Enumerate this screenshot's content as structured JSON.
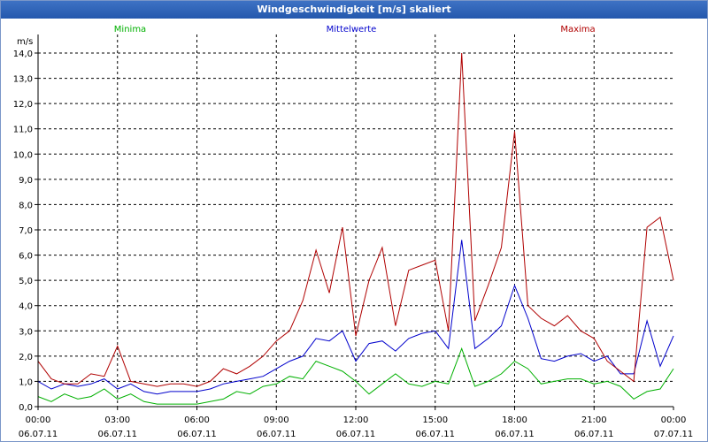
{
  "window": {
    "title": "Windgeschwindigkeit [m/s] skaliert"
  },
  "chart_data": {
    "type": "line",
    "title": "Windgeschwindigkeit [m/s] skaliert",
    "ylabel": "m/s",
    "ylim": [
      0,
      14
    ],
    "xlim": [
      0,
      24
    ],
    "y_ticks": [
      "0,0",
      "1,0",
      "2,0",
      "3,0",
      "4,0",
      "5,0",
      "6,0",
      "7,0",
      "8,0",
      "9,0",
      "10,0",
      "11,0",
      "12,0",
      "13,0",
      "14,0"
    ],
    "x_ticks": [
      {
        "time": "00:00",
        "date": "06.07.11"
      },
      {
        "time": "03:00",
        "date": "06.07.11"
      },
      {
        "time": "06:00",
        "date": "06.07.11"
      },
      {
        "time": "09:00",
        "date": "06.07.11"
      },
      {
        "time": "12:00",
        "date": "06.07.11"
      },
      {
        "time": "15:00",
        "date": "06.07.11"
      },
      {
        "time": "18:00",
        "date": "06.07.11"
      },
      {
        "time": "21:00",
        "date": "06.07.11"
      },
      {
        "time": "00:00",
        "date": "07.07.11"
      }
    ],
    "grid": true,
    "legend_position": "top",
    "series": [
      {
        "name": "Minima",
        "color": "#00b000",
        "x": [
          0,
          0.5,
          1,
          1.5,
          2,
          2.5,
          3,
          3.5,
          4,
          4.5,
          5,
          5.5,
          6,
          6.5,
          7,
          7.5,
          8,
          8.5,
          9,
          9.5,
          10,
          10.5,
          11,
          11.5,
          12,
          12.5,
          13,
          13.5,
          14,
          14.5,
          15,
          15.5,
          16,
          16.5,
          17,
          17.5,
          18,
          18.5,
          19,
          19.5,
          20,
          20.5,
          21,
          21.5,
          22,
          22.5,
          23,
          23.5,
          24
        ],
        "values": [
          0.4,
          0.2,
          0.5,
          0.3,
          0.4,
          0.7,
          0.3,
          0.5,
          0.2,
          0.1,
          0.1,
          0.1,
          0.1,
          0.2,
          0.3,
          0.6,
          0.5,
          0.8,
          0.9,
          1.2,
          1.1,
          1.8,
          1.6,
          1.4,
          1.0,
          0.5,
          0.9,
          1.3,
          0.9,
          0.8,
          1.0,
          0.9,
          2.3,
          0.8,
          1.0,
          1.3,
          1.8,
          1.5,
          0.9,
          1.0,
          1.1,
          1.1,
          0.9,
          1.0,
          0.8,
          0.3,
          0.6,
          0.7,
          1.5
        ]
      },
      {
        "name": "Mittelwerte",
        "color": "#0000cc",
        "x": [
          0,
          0.5,
          1,
          1.5,
          2,
          2.5,
          3,
          3.5,
          4,
          4.5,
          5,
          5.5,
          6,
          6.5,
          7,
          7.5,
          8,
          8.5,
          9,
          9.5,
          10,
          10.5,
          11,
          11.5,
          12,
          12.5,
          13,
          13.5,
          14,
          14.5,
          15,
          15.5,
          16,
          16.5,
          17,
          17.5,
          18,
          18.5,
          19,
          19.5,
          20,
          20.5,
          21,
          21.5,
          22,
          22.5,
          23,
          23.5,
          24
        ],
        "values": [
          1.0,
          0.7,
          0.9,
          0.8,
          0.9,
          1.1,
          0.7,
          0.9,
          0.6,
          0.5,
          0.6,
          0.6,
          0.6,
          0.7,
          0.9,
          1.0,
          1.1,
          1.2,
          1.5,
          1.8,
          2.0,
          2.7,
          2.6,
          3.0,
          1.8,
          2.5,
          2.6,
          2.2,
          2.7,
          2.9,
          3.0,
          2.3,
          6.6,
          2.3,
          2.7,
          3.2,
          4.8,
          3.5,
          1.9,
          1.8,
          2.0,
          2.1,
          1.8,
          2.0,
          1.3,
          1.3,
          3.4,
          1.6,
          2.8
        ]
      },
      {
        "name": "Maxima",
        "color": "#b00000",
        "x": [
          0,
          0.5,
          1,
          1.5,
          2,
          2.5,
          3,
          3.5,
          4,
          4.5,
          5,
          5.5,
          6,
          6.5,
          7,
          7.5,
          8,
          8.5,
          9,
          9.5,
          10,
          10.5,
          11,
          11.5,
          12,
          12.5,
          13,
          13.5,
          14,
          14.5,
          15,
          15.5,
          16,
          16.5,
          17,
          17.5,
          18,
          18.5,
          19,
          19.5,
          20,
          20.5,
          21,
          21.5,
          22,
          22.5,
          23,
          23.5,
          24
        ],
        "values": [
          1.8,
          1.1,
          0.9,
          0.9,
          1.3,
          1.2,
          2.4,
          1.0,
          0.9,
          0.8,
          0.9,
          0.9,
          0.8,
          1.0,
          1.5,
          1.3,
          1.6,
          2.0,
          2.6,
          3.0,
          4.2,
          6.2,
          4.5,
          7.1,
          2.8,
          5.0,
          6.3,
          3.2,
          5.4,
          5.6,
          5.8,
          3.0,
          14.0,
          3.4,
          4.8,
          6.3,
          10.9,
          4.0,
          3.5,
          3.2,
          3.6,
          3.0,
          2.7,
          1.8,
          1.4,
          1.0,
          7.1,
          7.5,
          5.0
        ]
      }
    ]
  }
}
